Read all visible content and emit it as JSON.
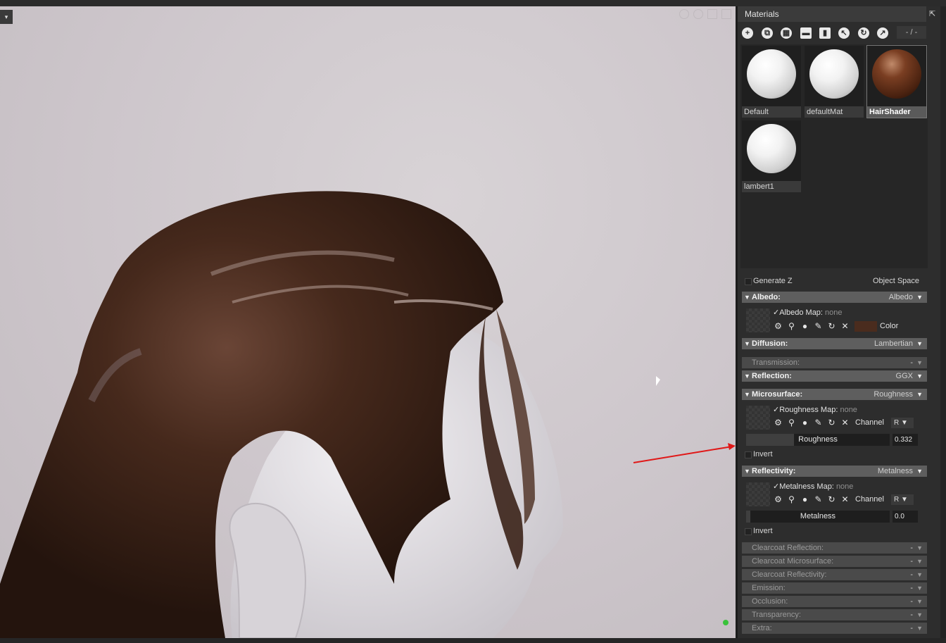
{
  "viewport": {
    "menu_glyph": "▾"
  },
  "panel": {
    "tab_title": "Materials",
    "popout_glyph": "⇱",
    "toolbar_icons": [
      "add-material-icon",
      "duplicate-icon",
      "checker-icon",
      "folder-icon",
      "delete-icon",
      "pick-icon",
      "refresh-icon",
      "export-icon"
    ],
    "toolbar_field": "- / -",
    "materials": [
      {
        "label": "Default",
        "sphere": "white"
      },
      {
        "label": "defaultMat",
        "sphere": "white"
      },
      {
        "label": "HairShader",
        "sphere": "brown",
        "selected": true
      },
      {
        "label": "lambert1",
        "sphere": "white"
      }
    ],
    "top_options": {
      "generate_z": "Generate Z",
      "object_space": "Object Space"
    },
    "albedo": {
      "title": "Albedo:",
      "value": "Albedo",
      "map_label": "✓Albedo Map:",
      "map_value": "none",
      "color_label": "Color",
      "color_swatch": "#4a2c1e"
    },
    "diffusion": {
      "title": "Diffusion:",
      "value": "Lambertian"
    },
    "transmission": {
      "title": "Transmission:",
      "value": "-"
    },
    "reflection": {
      "title": "Reflection:",
      "value": "GGX"
    },
    "microsurface": {
      "title": "Microsurface:",
      "value": "Roughness",
      "map_label": "✓Roughness Map:",
      "map_value": "none",
      "channel_label": "Channel",
      "channel_value": "R",
      "slider_label": "Roughness",
      "slider_value": "0.332",
      "invert_label": "Invert"
    },
    "reflectivity": {
      "title": "Reflectivity:",
      "value": "Metalness",
      "map_label": "✓Metalness Map:",
      "map_value": "none",
      "channel_label": "Channel",
      "channel_value": "R",
      "slider_label": "Metalness",
      "slider_value": "0.0",
      "invert_label": "Invert"
    },
    "collapsed_sections": [
      {
        "title": "Clearcoat Reflection:",
        "value": "-"
      },
      {
        "title": "Clearcoat Microsurface:",
        "value": "-"
      },
      {
        "title": "Clearcoat Reflectivity:",
        "value": "-"
      },
      {
        "title": "Emission:",
        "value": "-"
      },
      {
        "title": "Occlusion:",
        "value": "-"
      },
      {
        "title": "Transparency:",
        "value": "-"
      },
      {
        "title": "Extra:",
        "value": "-"
      }
    ]
  },
  "colors": {
    "annotation_arrow": "#e01818",
    "status_dot": "#39c23a",
    "hair": "#3d2419"
  }
}
